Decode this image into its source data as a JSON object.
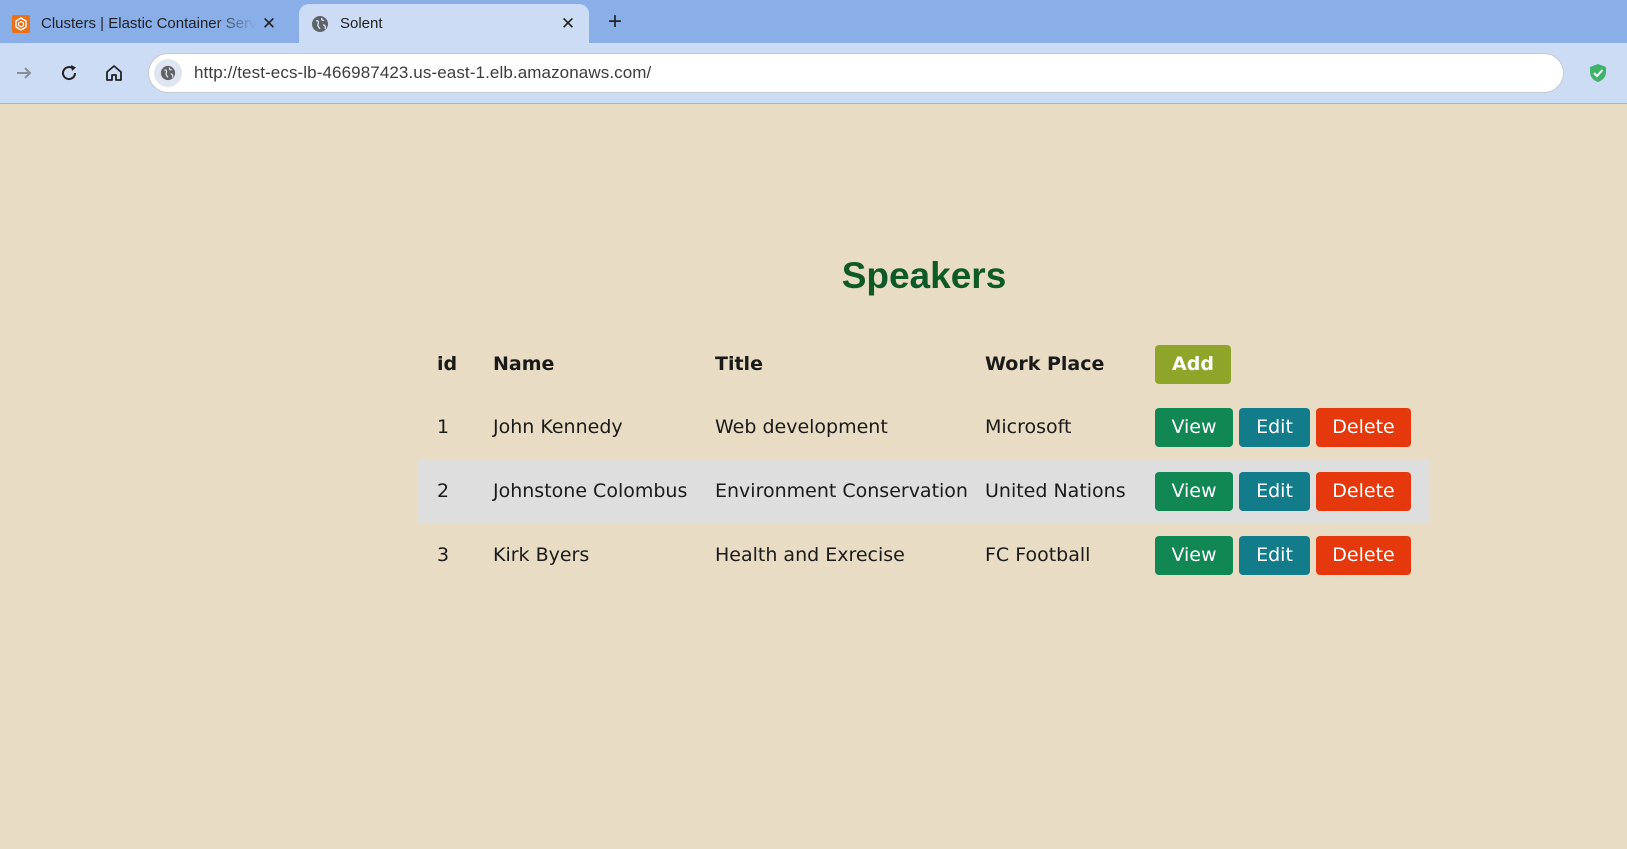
{
  "browser": {
    "tabs": [
      {
        "title": "Clusters | Elastic Container Servi",
        "active": false,
        "icon": "aws-ecs-icon"
      },
      {
        "title": "Solent",
        "active": true,
        "icon": "globe-icon"
      }
    ],
    "close_glyph": "✕",
    "newtab_glyph": "+",
    "url": "http://test-ecs-lb-466987423.us-east-1.elb.amazonaws.com/"
  },
  "page": {
    "title": "Speakers",
    "headers": {
      "id": "id",
      "name": "Name",
      "title": "Title",
      "work_place": "Work Place"
    },
    "add_label": "Add",
    "rows": [
      {
        "id": "1",
        "name": "John Kennedy",
        "title": "Web development",
        "work_place": "Microsoft"
      },
      {
        "id": "2",
        "name": "Johnstone Colombus",
        "title": "Environment Conservation",
        "work_place": "United Nations"
      },
      {
        "id": "3",
        "name": "Kirk Byers",
        "title": "Health and Exrecise",
        "work_place": "FC Football"
      }
    ],
    "actions": {
      "view": "View",
      "edit": "Edit",
      "delete": "Delete"
    }
  },
  "colors": {
    "page_bg": "#e8dcc4",
    "title": "#0e5a26",
    "add": "#8fa52a",
    "view": "#118753",
    "edit": "#137c8b",
    "delete": "#e6380d",
    "tabstrip": "#8aaee8",
    "toolbar": "#cddcf5"
  }
}
